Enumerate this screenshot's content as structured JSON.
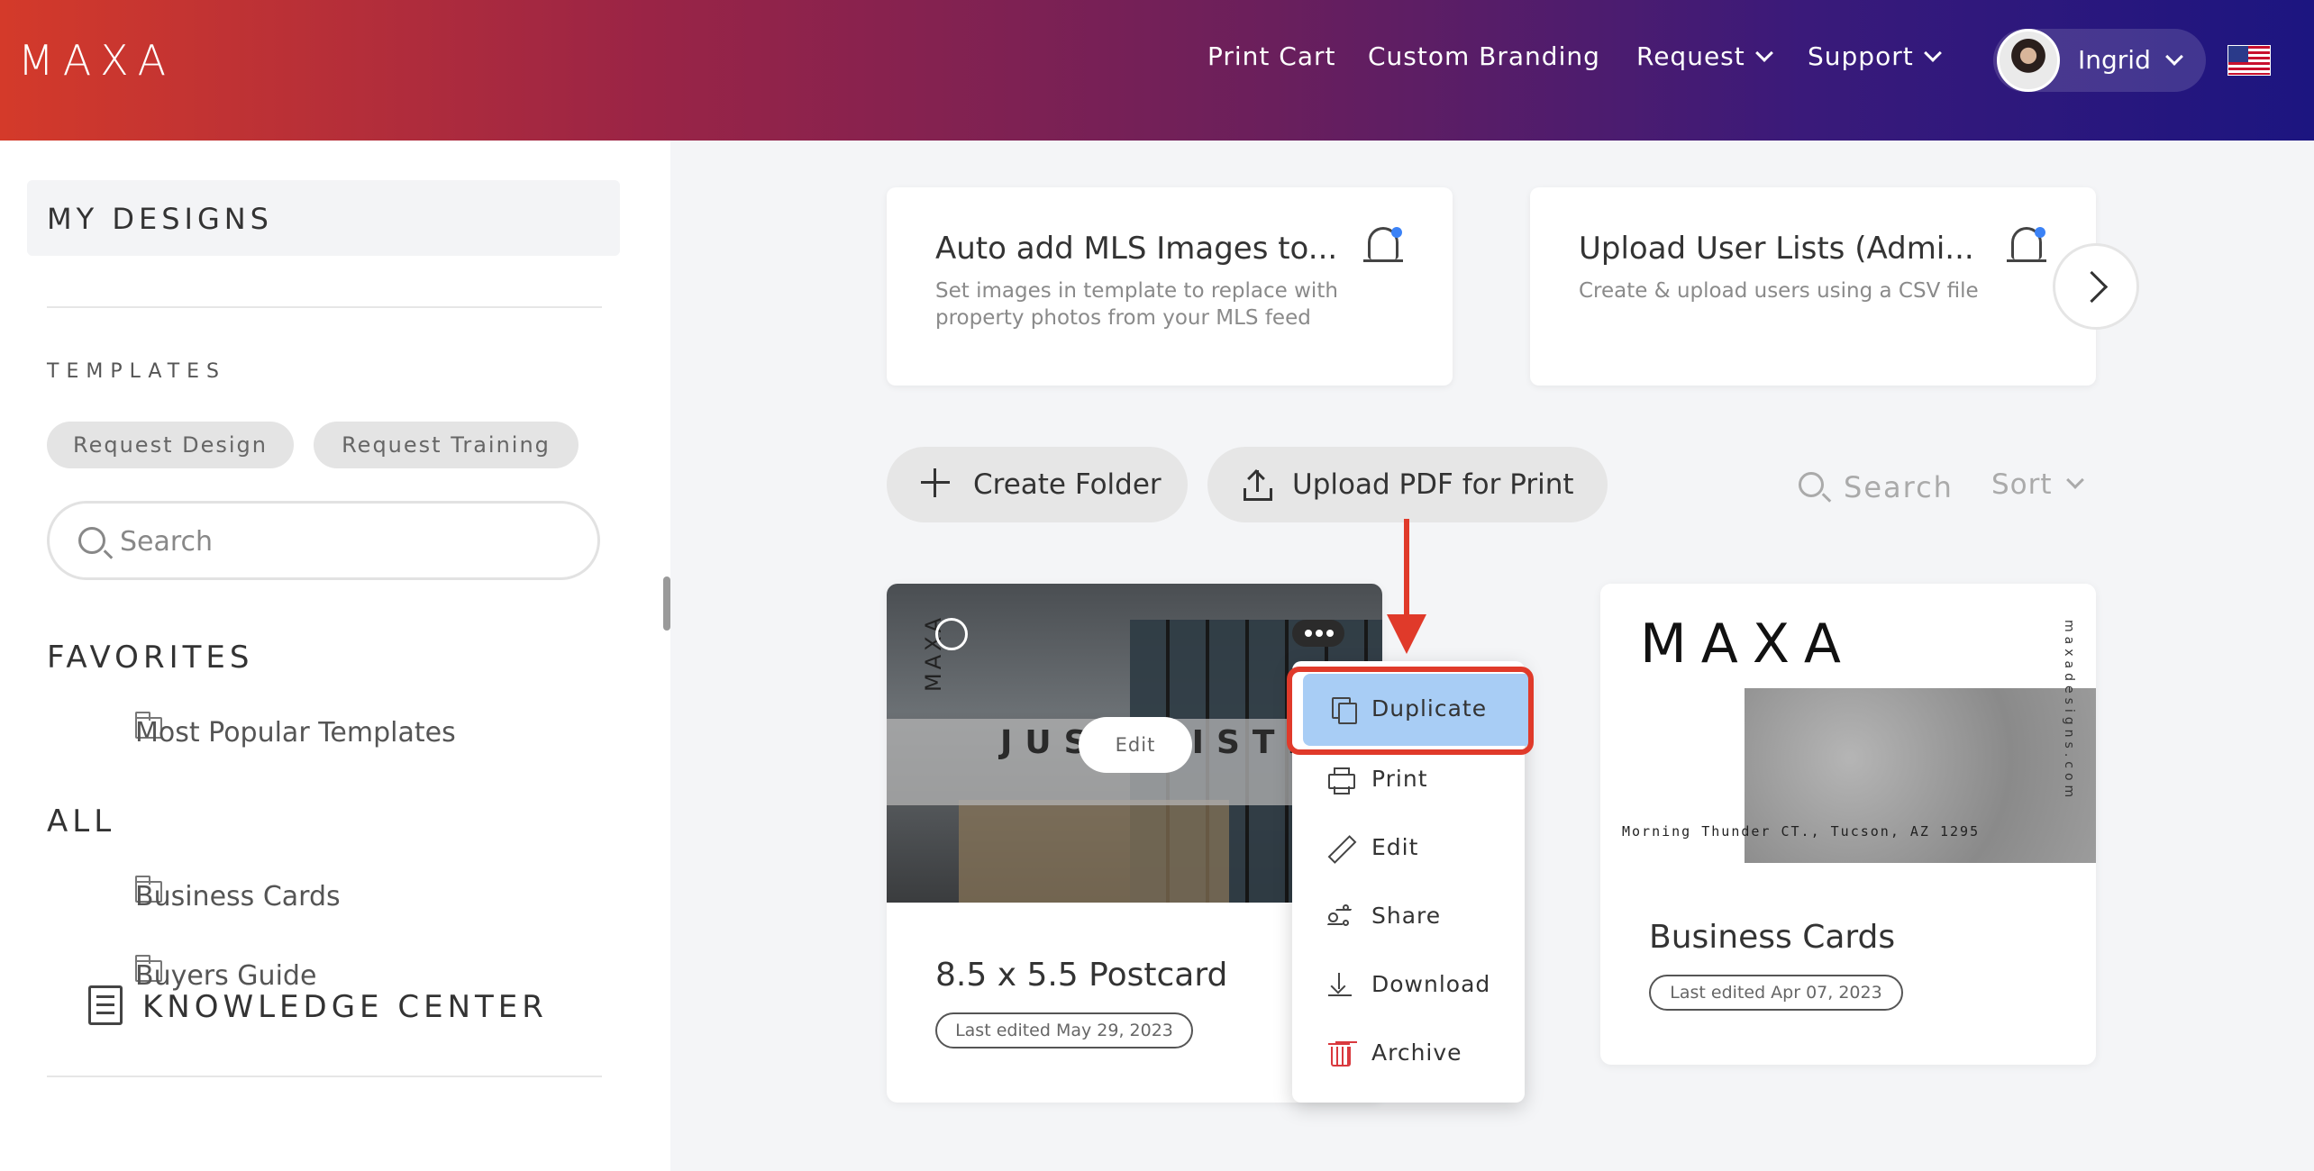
{
  "header": {
    "logo": "MAXA",
    "nav": [
      {
        "label": "Print Cart"
      },
      {
        "label": "Custom Branding"
      },
      {
        "label": "Request"
      },
      {
        "label": "Support"
      }
    ],
    "user": {
      "name": "Ingrid"
    }
  },
  "sidebar": {
    "title": "MY DESIGNS",
    "templates_label": "TEMPLATES",
    "chips": [
      "Request Design",
      "Request Training"
    ],
    "search_placeholder": "Search",
    "favorites_title": "FAVORITES",
    "favorites": [
      "Most Popular Templates"
    ],
    "all_title": "ALL",
    "all_folders": [
      "Business Cards",
      "Buyers Guide"
    ],
    "knowledge_center": "KNOWLEDGE CENTER"
  },
  "notices": [
    {
      "title": "Auto add MLS Images to...",
      "description": "Set images in template to replace with property photos from your MLS feed"
    },
    {
      "title": "Upload User Lists (Admi...",
      "description": "Create & upload users using a CSV file"
    }
  ],
  "toolbar": {
    "create_folder": "Create Folder",
    "upload_pdf": "Upload PDF for Print",
    "search": "Search",
    "sort": "Sort"
  },
  "designs": [
    {
      "title": "8.5 x 5.5 Postcard",
      "last_edited": "Last edited May 29, 2023",
      "thumb_brand": "MAXA",
      "thumb_headline": "JUST LISTED",
      "edit_label": "Edit"
    },
    {
      "title": "Business Cards",
      "last_edited": "Last edited Apr 07, 2023",
      "thumb_brand": "MAXA",
      "thumb_address": "Morning Thunder CT., Tucson, AZ 1295",
      "thumb_web": "maxadesigns.com"
    }
  ],
  "context_menu": {
    "items": [
      "Duplicate",
      "Print",
      "Edit",
      "Share",
      "Download",
      "Archive"
    ],
    "active": "Duplicate"
  },
  "colors": {
    "accent_highlight": "#e03a2a",
    "menu_active": "#a8cdf5",
    "notification_dot": "#3b82f6",
    "archive_icon": "#d9393e"
  }
}
